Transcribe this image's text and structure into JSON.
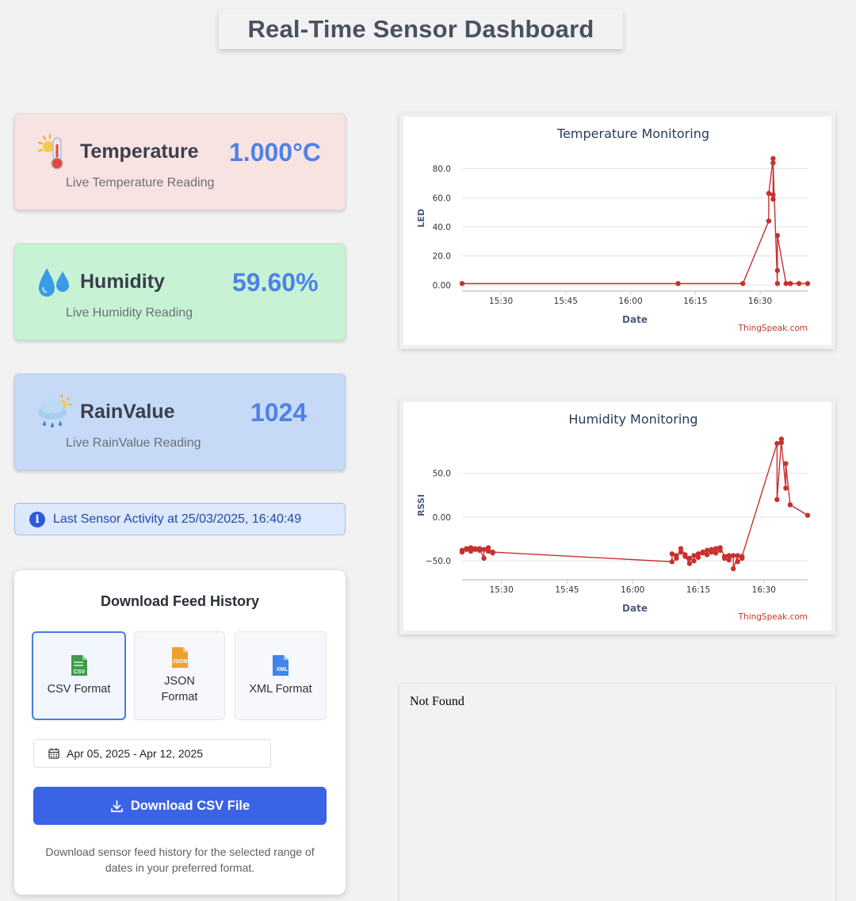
{
  "header": {
    "title": "Real-Time Sensor Dashboard"
  },
  "cards": [
    {
      "label": "Temperature",
      "value": "1.000°C",
      "sub": "Live Temperature Reading",
      "icon": "thermometer-icon"
    },
    {
      "label": "Humidity",
      "value": "59.60%",
      "sub": "Live Humidity Reading",
      "icon": "droplets-icon"
    },
    {
      "label": "RainValue",
      "value": "1024",
      "sub": "Live RainValue Reading",
      "icon": "rain-cloud-icon"
    }
  ],
  "activity": {
    "text": "Last Sensor Activity at 25/03/2025, 16:40:49"
  },
  "download": {
    "title": "Download Feed History",
    "formats": [
      {
        "label": "CSV Format",
        "badge": "CSV",
        "color": "#3f9b4c",
        "active": true
      },
      {
        "label": "JSON Format",
        "badge": "JSON",
        "color": "#f0a030",
        "active": false
      },
      {
        "label": "XML Format",
        "badge": "XML",
        "color": "#3f86e8",
        "active": false
      }
    ],
    "date_range": "Apr 05, 2025 - Apr 12, 2025",
    "button": "Download CSV File",
    "description": "Download sensor feed history for the selected range of dates in your preferred format."
  },
  "chart_data": [
    {
      "type": "line",
      "title": "Temperature Monitoring",
      "xlabel": "Date",
      "ylabel": "LED",
      "credit": "ThingSpeak.com",
      "x_ticks": [
        "15:30",
        "15:45",
        "16:00",
        "16:15",
        "16:30"
      ],
      "y_ticks": [
        "0.00",
        "20.0",
        "40.0",
        "60.0",
        "80.0"
      ],
      "xlim": [
        "15:21",
        "16:41"
      ],
      "ylim": [
        -2,
        94
      ],
      "grid": true,
      "points": [
        [
          "15:21",
          1
        ],
        [
          "16:11",
          1
        ],
        [
          "16:26",
          1
        ],
        [
          "16:32",
          44
        ],
        [
          "16:32",
          63
        ],
        [
          "16:33",
          87
        ],
        [
          "16:33",
          62
        ],
        [
          "16:33",
          59
        ],
        [
          "16:33",
          84
        ],
        [
          "16:34",
          1
        ],
        [
          "16:34",
          10
        ],
        [
          "16:34",
          34
        ],
        [
          "16:36",
          1
        ],
        [
          "16:37",
          1
        ],
        [
          "16:39",
          1
        ],
        [
          "16:41",
          1
        ]
      ],
      "color": "#c8312e"
    },
    {
      "type": "line",
      "title": "Humidity Monitoring",
      "xlabel": "Date",
      "ylabel": "RSSI",
      "credit": "ThingSpeak.com",
      "x_ticks": [
        "15:30",
        "15:45",
        "16:00",
        "16:15",
        "16:30"
      ],
      "y_ticks": [
        "−50.0",
        "0.00",
        "50.0"
      ],
      "xlim": [
        "15:21",
        "16:40"
      ],
      "ylim": [
        -68,
        95
      ],
      "grid": true,
      "points": [
        [
          "15:21",
          -38
        ],
        [
          "15:21",
          -40
        ],
        [
          "15:22",
          -37
        ],
        [
          "15:22",
          -36
        ],
        [
          "15:23",
          -39
        ],
        [
          "15:23",
          -35
        ],
        [
          "15:24",
          -37
        ],
        [
          "15:24",
          -36
        ],
        [
          "15:25",
          -38
        ],
        [
          "15:25",
          -36
        ],
        [
          "15:26",
          -47
        ],
        [
          "15:26",
          -37
        ],
        [
          "15:27",
          -39
        ],
        [
          "15:27",
          -35
        ],
        [
          "15:28",
          -41
        ],
        [
          "15:28",
          -40
        ],
        [
          "16:09",
          -51
        ],
        [
          "16:09",
          -42
        ],
        [
          "16:10",
          -47
        ],
        [
          "16:10",
          -44
        ],
        [
          "16:11",
          -40
        ],
        [
          "16:11",
          -36
        ],
        [
          "16:12",
          -43
        ],
        [
          "16:12",
          -45
        ],
        [
          "16:13",
          -53
        ],
        [
          "16:13",
          -47
        ],
        [
          "16:14",
          -50
        ],
        [
          "16:14",
          -44
        ],
        [
          "16:15",
          -46
        ],
        [
          "16:15",
          -42
        ],
        [
          "16:16",
          -41
        ],
        [
          "16:16",
          -40
        ],
        [
          "16:17",
          -43
        ],
        [
          "16:17",
          -38
        ],
        [
          "16:18",
          -40
        ],
        [
          "16:18",
          -37
        ],
        [
          "16:19",
          -41
        ],
        [
          "16:19",
          -36
        ],
        [
          "16:20",
          -38
        ],
        [
          "16:20",
          -35
        ],
        [
          "16:21",
          -45
        ],
        [
          "16:21",
          -47
        ],
        [
          "16:22",
          -44
        ],
        [
          "16:22",
          -49
        ],
        [
          "16:23",
          -44
        ],
        [
          "16:23",
          -59
        ],
        [
          "16:24",
          -44
        ],
        [
          "16:24",
          -51
        ],
        [
          "16:25",
          -47
        ],
        [
          "16:25",
          -45
        ],
        [
          "16:33",
          84
        ],
        [
          "16:33",
          20
        ],
        [
          "16:34",
          89
        ],
        [
          "16:34",
          85
        ],
        [
          "16:35",
          33
        ],
        [
          "16:35",
          61
        ],
        [
          "16:36",
          14
        ],
        [
          "16:40",
          2
        ]
      ],
      "color": "#c8312e"
    }
  ],
  "notfound": {
    "text": "Not Found"
  }
}
